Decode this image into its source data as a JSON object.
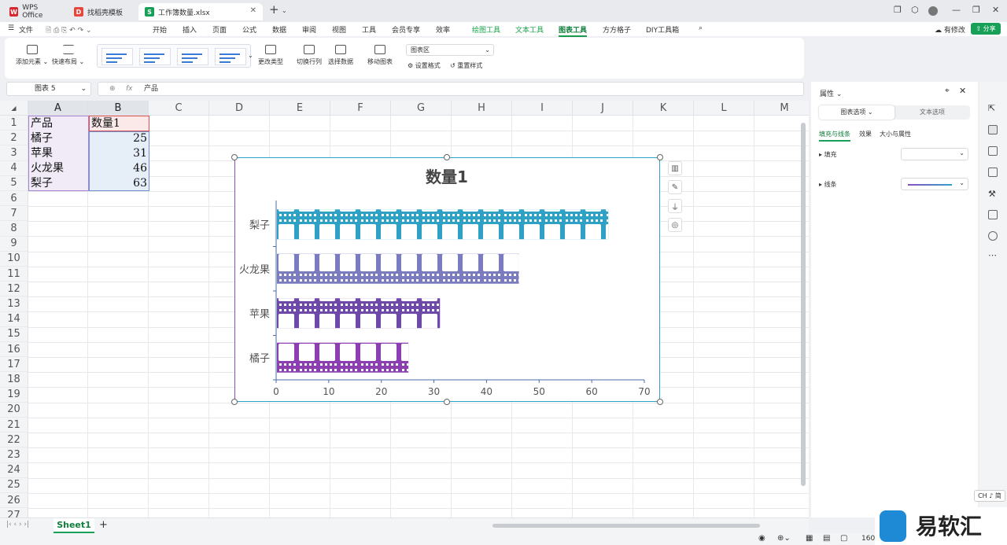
{
  "tabs": [
    {
      "label": "WPS Office",
      "icon": "wps-logo-icon",
      "color": "#d7282f"
    },
    {
      "label": "找稻壳模板",
      "icon": "docer-icon",
      "color": "#e6473a"
    },
    {
      "label": "工作簿数量.xlsx",
      "icon": "spreadsheet-icon",
      "color": "#18a058"
    }
  ],
  "menu": {
    "file": "文件",
    "items": [
      "开始",
      "插入",
      "页面",
      "公式",
      "数据",
      "审阅",
      "视图",
      "工具",
      "会员专享",
      "效率"
    ],
    "context_items": [
      "绘图工具",
      "文本工具",
      "图表工具"
    ],
    "extra_items": [
      "方方格子",
      "DIY工具箱"
    ],
    "active": "图表工具",
    "modified": "有修改",
    "share": "分享"
  },
  "toolbar": {
    "add_element": "添加元素",
    "quick_layout": "快速布局",
    "change_type": "更改类型",
    "switch_row_col": "切换行列",
    "select_data": "选择数据",
    "move_chart": "移动图表",
    "chart_area_select": "图表区",
    "set_format": "设置格式",
    "reset_style": "重置样式"
  },
  "formula_bar": {
    "name_box": "图表 5",
    "fx": "fx",
    "value": "产品"
  },
  "columns": [
    "A",
    "B",
    "C",
    "D",
    "E",
    "F",
    "G",
    "H",
    "I",
    "J",
    "K",
    "L",
    "M"
  ],
  "rows": [
    "1",
    "2",
    "3",
    "4",
    "5",
    "6",
    "7",
    "8",
    "9",
    "10",
    "11",
    "12",
    "13",
    "14",
    "15",
    "16",
    "17",
    "18",
    "19",
    "20",
    "21",
    "22",
    "23",
    "24",
    "25",
    "26",
    "27"
  ],
  "cells": {
    "header": [
      "产品",
      "数量1"
    ],
    "data": [
      [
        "橘子",
        "25"
      ],
      [
        "苹果",
        "31"
      ],
      [
        "火龙果",
        "46"
      ],
      [
        "梨子",
        "63"
      ]
    ]
  },
  "chart_data": {
    "type": "bar",
    "orientation": "horizontal",
    "title": "数量1",
    "categories": [
      "橘子",
      "苹果",
      "火龙果",
      "梨子"
    ],
    "series": [
      {
        "name": "数量1",
        "values": [
          25,
          31,
          46,
          63
        ]
      }
    ],
    "xlim": [
      0,
      70
    ],
    "ticks": [
      "0",
      "10",
      "20",
      "30",
      "40",
      "50",
      "60",
      "70"
    ],
    "bar_colors": [
      "#8b3fb1",
      "#6f49a9",
      "#7b7cc0",
      "#2ea1c4"
    ],
    "grid": false,
    "legend": "none"
  },
  "sheet_tab": "Sheet1",
  "panel": {
    "title": "属性",
    "seg_chart": "图表选项",
    "seg_text": "文本选项",
    "subtabs": [
      "填充与线条",
      "效果",
      "大小与属性"
    ],
    "fill": "填充",
    "line": "线条"
  },
  "status": {
    "zoom": "160",
    "ime": "CH ♪ 简"
  },
  "watermark": "易软汇"
}
